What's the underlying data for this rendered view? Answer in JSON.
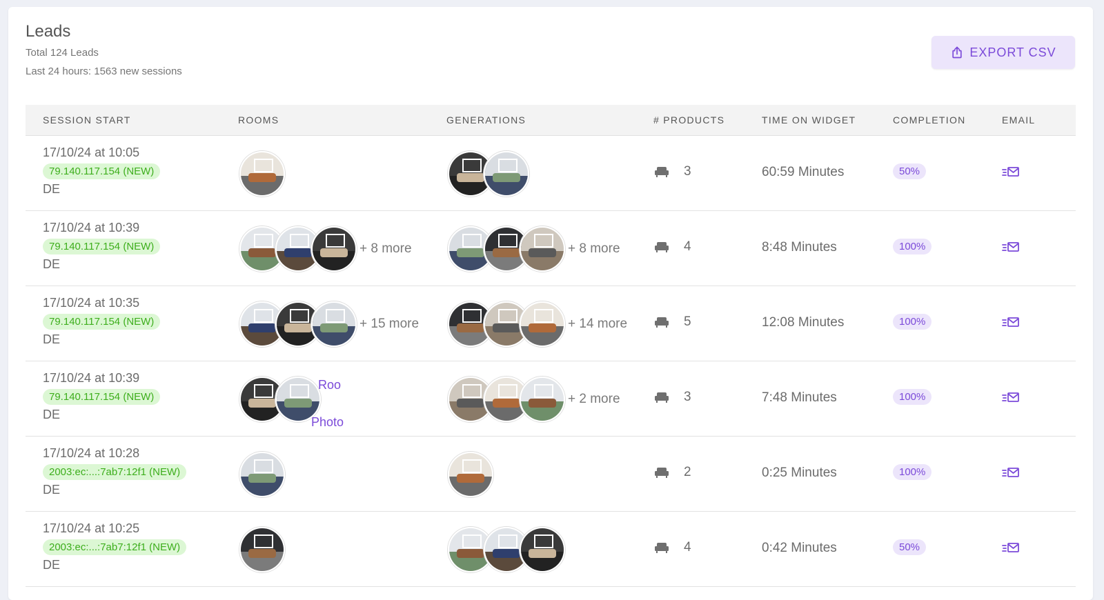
{
  "header": {
    "title": "Leads",
    "total": "Total 124 Leads",
    "sessions": "Last 24 hours: 1563 new sessions",
    "export_label": "EXPORT CSV"
  },
  "columns": [
    "SESSION START",
    "ROOMS",
    "GENERATIONS",
    "# PRODUCTS",
    "TIME ON WIDGET",
    "COMPLETION",
    "EMAIL"
  ],
  "icons": {
    "export": "share-upload-icon",
    "products": "armchair-icon",
    "email": "fast-mail-icon"
  },
  "colors": {
    "accent": "#7b4ad9",
    "accent_bg": "#ece5fb",
    "ip_text": "#3dae1c",
    "ip_bg": "#dcf7d4"
  },
  "rows": [
    {
      "date": "17/10/24 at 10:05",
      "ip": "79.140.117.154 (NEW)",
      "country": "DE",
      "rooms_more": "",
      "gens_more": "",
      "products": "3",
      "time": "60:59 Minutes",
      "completion": "50%"
    },
    {
      "date": "17/10/24 at 10:39",
      "ip": "79.140.117.154 (NEW)",
      "country": "DE",
      "rooms_more": "+ 8 more",
      "gens_more": "+ 8 more",
      "products": "4",
      "time": "8:48 Minutes",
      "completion": "100%"
    },
    {
      "date": "17/10/24 at 10:35",
      "ip": "79.140.117.154 (NEW)",
      "country": "DE",
      "rooms_more": "+ 15 more",
      "gens_more": "+ 14 more",
      "products": "5",
      "time": "12:08 Minutes",
      "completion": "100%"
    },
    {
      "date": "17/10/24 at 10:39",
      "ip": "79.140.117.154 (NEW)",
      "country": "DE",
      "rooms_broken_1": "Roo",
      "rooms_broken_2": "Photo",
      "gens_more": "+ 2 more",
      "products": "3",
      "time": "7:48 Minutes",
      "completion": "100%"
    },
    {
      "date": "17/10/24 at 10:28",
      "ip": "2003:ec:...:7ab7:12f1 (NEW)",
      "country": "DE",
      "rooms_more": "",
      "gens_more": "",
      "products": "2",
      "time": "0:25 Minutes",
      "completion": "100%"
    },
    {
      "date": "17/10/24 at 10:25",
      "ip": "2003:ec:...:7ab7:12f1 (NEW)",
      "country": "DE",
      "rooms_more": "",
      "gens_more": "",
      "products": "4",
      "time": "0:42 Minutes",
      "completion": "50%"
    }
  ]
}
